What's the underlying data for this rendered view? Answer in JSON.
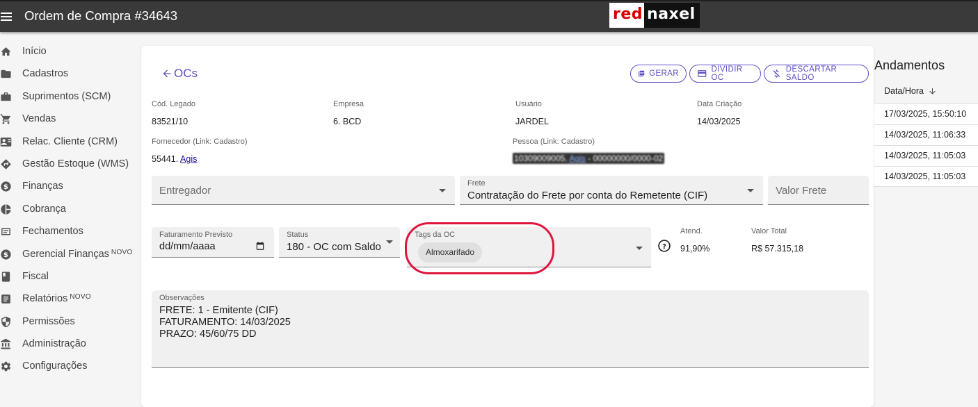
{
  "app": {
    "title": "Ordem de Compra #34643",
    "logo_red": "red",
    "logo_black": "naxel"
  },
  "sidebar": {
    "items": [
      {
        "label": "Início",
        "icon": "home-icon"
      },
      {
        "label": "Cadastros",
        "icon": "folder-icon"
      },
      {
        "label": "Suprimentos (SCM)",
        "icon": "briefcase-icon"
      },
      {
        "label": "Vendas",
        "icon": "cart-icon"
      },
      {
        "label": "Relac. Cliente (CRM)",
        "icon": "contact-card-icon"
      },
      {
        "label": "Gestão Estoque (WMS)",
        "icon": "directions-icon"
      },
      {
        "label": "Finanças",
        "icon": "dollar-icon"
      },
      {
        "label": "Cobrança",
        "icon": "pie-chart-icon"
      },
      {
        "label": "Fechamentos",
        "icon": "list-icon"
      },
      {
        "label": "Gerencial Finanças",
        "icon": "dollar-icon",
        "badge": "NOVO"
      },
      {
        "label": "Fiscal",
        "icon": "book-icon"
      },
      {
        "label": "Relatórios",
        "icon": "report-icon",
        "badge": "NOVO"
      },
      {
        "label": "Permissões",
        "icon": "shield-icon"
      },
      {
        "label": "Administração",
        "icon": "bank-icon"
      },
      {
        "label": "Configurações",
        "icon": "gear-icon"
      }
    ]
  },
  "header": {
    "back_label": "OCs",
    "actions": {
      "gerar": "GERAR",
      "dividir": "DIVIDIR OC",
      "descartar": "DESCARTAR SALDO"
    }
  },
  "info": {
    "cod_legado_label": "Cód. Legado",
    "cod_legado": "83521/10",
    "empresa_label": "Empresa",
    "empresa": "6. BCD",
    "usuario_label": "Usuário",
    "usuario": "JARDEL",
    "data_criacao_label": "Data Criação",
    "data_criacao": "14/03/2025",
    "fornecedor_label": "Fornecedor (Link: Cadastro)",
    "fornecedor_code": "55441.",
    "fornecedor_link": "Agis",
    "pessoa_label": "Pessoa (Link: Cadastro)",
    "pessoa_prefix": "10309009005.",
    "pessoa_link": "Agis",
    "pessoa_suffix": "- 00000000/0000-02"
  },
  "form": {
    "entregador_placeholder": "Entregador",
    "frete_label": "Frete",
    "frete_value": "Contratação do Frete por conta do Remetente (CIF)",
    "valor_frete_placeholder": "Valor Frete",
    "faturamento_label": "Faturamento Previsto",
    "faturamento_value": "dd/mm/aaaa",
    "status_label": "Status",
    "status_value": "180 - OC com Saldo",
    "tags_label": "Tags da OC",
    "tags": [
      "Almoxarifado"
    ],
    "atend_label": "Atend.",
    "atend_value": "91,90%",
    "valor_total_label": "Valor Total",
    "valor_total_value": "R$ 57.315,18",
    "obs_label": "Observações",
    "obs_lines": [
      "FRETE: 1 - Emitente (CIF)",
      "FATURAMENTO: 14/03/2025",
      "PRAZO: 45/60/75 DD"
    ]
  },
  "andamentos": {
    "title": "Andamentos",
    "column": "Data/Hora",
    "rows": [
      "17/03/2025, 15:50:10",
      "14/03/2025, 11:06:33",
      "14/03/2025, 11:05:03",
      "14/03/2025, 11:05:03"
    ]
  },
  "colors": {
    "accent": "#5c4fc4",
    "highlight": "#e0143c",
    "topbar": "#3a3a3a"
  }
}
